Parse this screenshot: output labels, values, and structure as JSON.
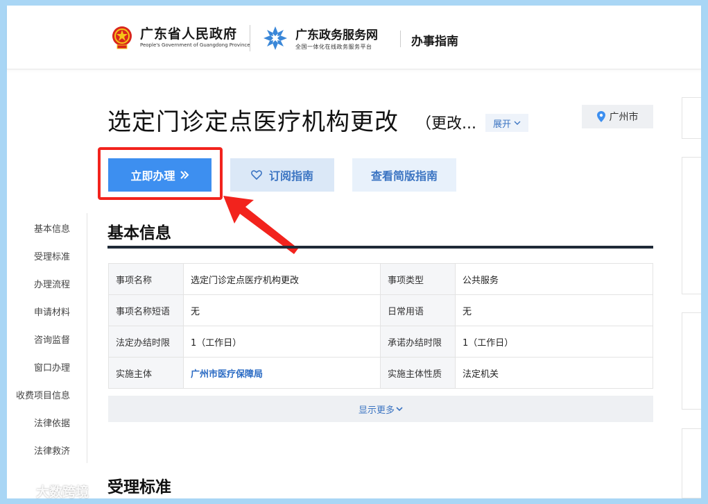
{
  "header": {
    "gov_name": "广东省人民政府",
    "gov_en": "People's Government of Guangdong Province",
    "portal_name": "广东政务服务网",
    "portal_slogan": "全国一体化在线政务服务平台",
    "guide_label": "办事指南"
  },
  "title": {
    "main": "选定门诊定点医疗机构更改",
    "sub": "（更改...",
    "expand_label": "展开",
    "location": "广州市"
  },
  "actions": {
    "apply_label": "立即办理",
    "subscribe_label": "订阅指南",
    "simple_label": "查看简版指南"
  },
  "side_nav": {
    "items": [
      {
        "label": "基本信息"
      },
      {
        "label": "受理标准"
      },
      {
        "label": "办理流程"
      },
      {
        "label": "申请材料"
      },
      {
        "label": "咨询监督"
      },
      {
        "label": "窗口办理"
      },
      {
        "label": "收费项目信息"
      },
      {
        "label": "法律依据"
      },
      {
        "label": "法律救济"
      }
    ]
  },
  "basic_info": {
    "section_title": "基本信息",
    "rows": [
      {
        "k1": "事项名称",
        "v1": "选定门诊定点医疗机构更改",
        "k2": "事项类型",
        "v2": "公共服务"
      },
      {
        "k1": "事项名称短语",
        "v1": "无",
        "k2": "日常用语",
        "v2": "无"
      },
      {
        "k1": "法定办结时限",
        "v1": "1（工作日）",
        "k2": "承诺办结时限",
        "v2": "1（工作日）"
      },
      {
        "k1": "实施主体",
        "v1": "广州市医疗保障局",
        "k2": "实施主体性质",
        "v2": "法定机关"
      }
    ],
    "show_more_label": "显示更多"
  },
  "section2": {
    "title": "受理标准"
  },
  "watermark": {
    "text": "大数跨境"
  },
  "colors": {
    "primary": "#3d8ff0",
    "highlight_red": "#f2231d",
    "link": "#2c6cc4",
    "frame": "#a9d6f5"
  }
}
